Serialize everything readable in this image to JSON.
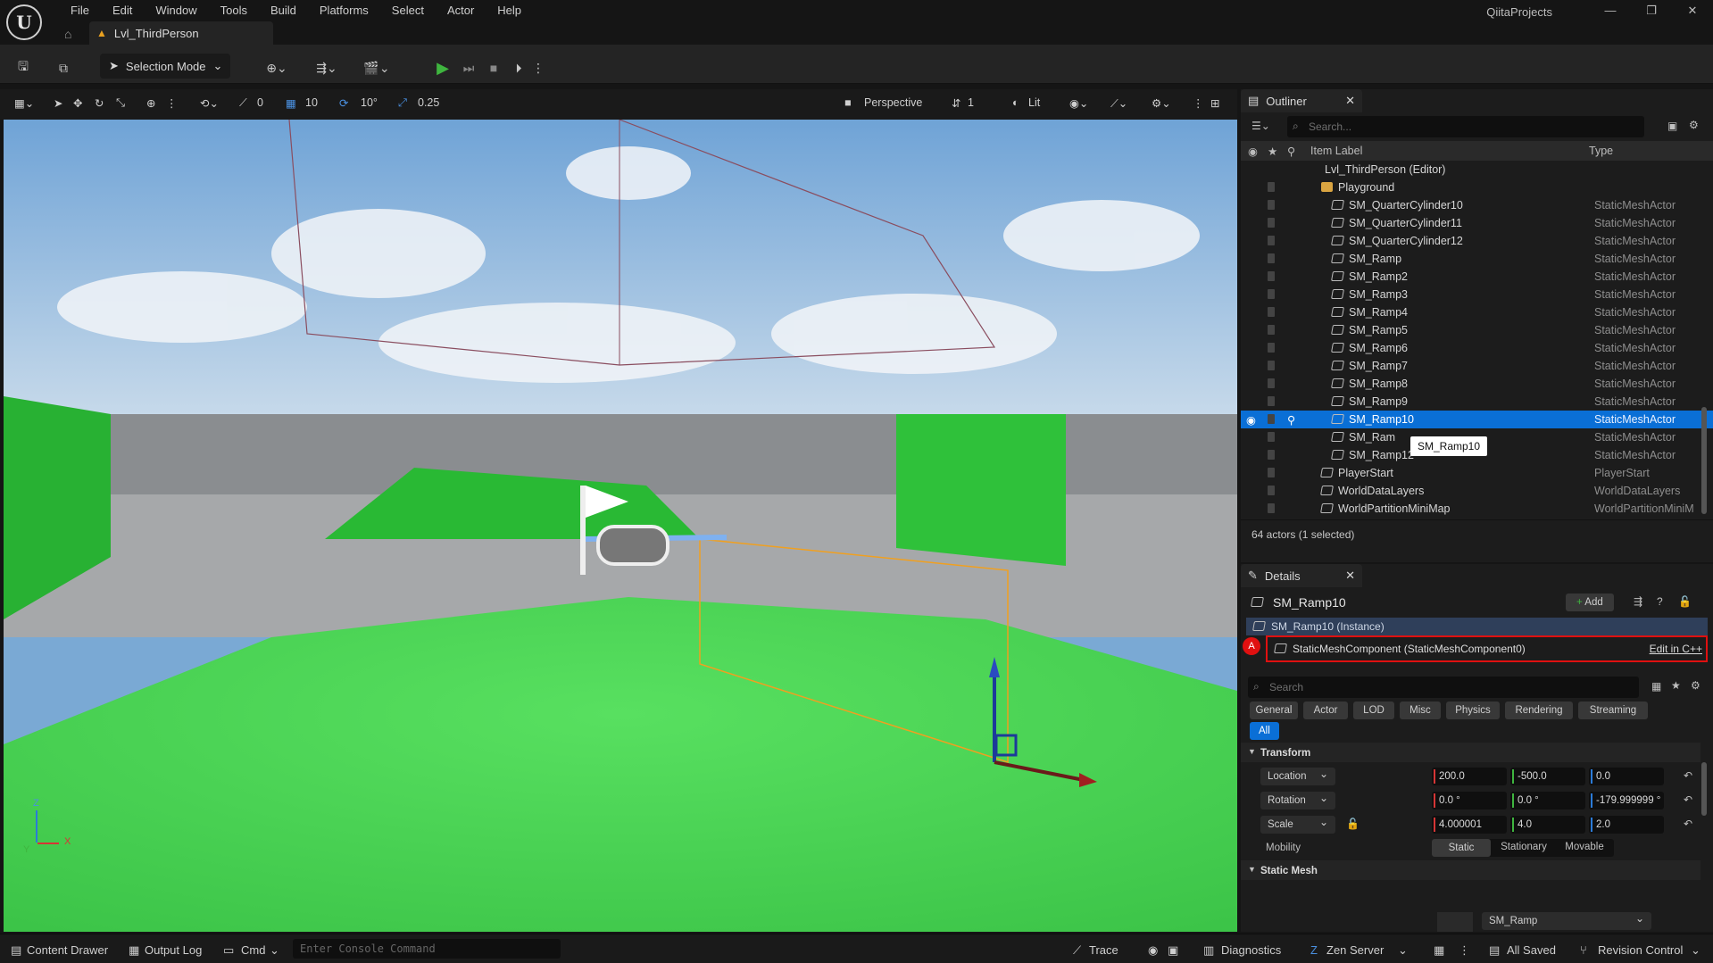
{
  "menubar": {
    "items": [
      "File",
      "Edit",
      "Window",
      "Tools",
      "Build",
      "Platforms",
      "Select",
      "Actor",
      "Help"
    ],
    "project": "QiitaProjects",
    "tab_label": "Lvl_ThirdPerson"
  },
  "toolbar": {
    "selection_mode": "Selection Mode"
  },
  "viewport_bar": {
    "grid_snap": "10",
    "rotation_snap": "10°",
    "scale_snap": "0.25",
    "zero_value": "0",
    "view_mode": "Perspective",
    "camera_speed": "1",
    "lighting": "Lit"
  },
  "viewport": {
    "axis_z": "Z",
    "axis_x": "X",
    "axis_y": "Y"
  },
  "outliner": {
    "title": "Outliner",
    "search_placeholder": "Search...",
    "col_label": "Item Label",
    "col_type": "Type",
    "rows": [
      {
        "label": "Lvl_ThirdPerson (Editor)",
        "type": "",
        "indent": 0
      },
      {
        "label": "Playground",
        "type": "",
        "indent": 1
      },
      {
        "label": "SM_QuarterCylinder10",
        "type": "StaticMeshActor",
        "indent": 2
      },
      {
        "label": "SM_QuarterCylinder11",
        "type": "StaticMeshActor",
        "indent": 2
      },
      {
        "label": "SM_QuarterCylinder12",
        "type": "StaticMeshActor",
        "indent": 2
      },
      {
        "label": "SM_Ramp",
        "type": "StaticMeshActor",
        "indent": 2
      },
      {
        "label": "SM_Ramp2",
        "type": "StaticMeshActor",
        "indent": 2
      },
      {
        "label": "SM_Ramp3",
        "type": "StaticMeshActor",
        "indent": 2
      },
      {
        "label": "SM_Ramp4",
        "type": "StaticMeshActor",
        "indent": 2
      },
      {
        "label": "SM_Ramp5",
        "type": "StaticMeshActor",
        "indent": 2
      },
      {
        "label": "SM_Ramp6",
        "type": "StaticMeshActor",
        "indent": 2
      },
      {
        "label": "SM_Ramp7",
        "type": "StaticMeshActor",
        "indent": 2
      },
      {
        "label": "SM_Ramp8",
        "type": "StaticMeshActor",
        "indent": 2
      },
      {
        "label": "SM_Ramp9",
        "type": "StaticMeshActor",
        "indent": 2
      },
      {
        "label": "SM_Ramp10",
        "type": "StaticMeshActor",
        "indent": 2,
        "selected": true
      },
      {
        "label": "SM_Ram",
        "type": "StaticMeshActor",
        "indent": 2
      },
      {
        "label": "SM_Ramp12",
        "type": "StaticMeshActor",
        "indent": 2
      },
      {
        "label": "PlayerStart",
        "type": "PlayerStart",
        "indent": 1
      },
      {
        "label": "WorldDataLayers",
        "type": "WorldDataLayers",
        "indent": 1
      },
      {
        "label": "WorldPartitionMiniMap",
        "type": "WorldPartitionMiniM",
        "indent": 1
      }
    ],
    "tooltip": "SM_Ramp10",
    "footer": "64 actors (1 selected)"
  },
  "details": {
    "title": "Details",
    "actor_name": "SM_Ramp10",
    "add_label": "Add",
    "instance_label": "SM_Ramp10 (Instance)",
    "component_label": "StaticMeshComponent (StaticMeshComponent0)",
    "edit_cpp": "Edit in C++",
    "search_placeholder": "Search",
    "filters": [
      "General",
      "Actor",
      "LOD",
      "Misc",
      "Physics",
      "Rendering",
      "Streaming"
    ],
    "filter_all": "All",
    "transform_section": "Transform",
    "location_label": "Location",
    "location": [
      "200.0",
      "-500.0",
      "0.0"
    ],
    "rotation_label": "Rotation",
    "rotation": [
      "0.0 °",
      "0.0 °",
      "-179.999999 °"
    ],
    "scale_label": "Scale",
    "scale": [
      "4.000001",
      "4.0",
      "2.0"
    ],
    "mobility_label": "Mobility",
    "mobility_options": [
      "Static",
      "Stationary",
      "Movable"
    ],
    "static_mesh_section": "Static Mesh",
    "static_mesh_value": "SM_Ramp"
  },
  "statusbar": {
    "content_drawer": "Content Drawer",
    "output_log": "Output Log",
    "cmd": "Cmd",
    "console_placeholder": "Enter Console Command",
    "trace": "Trace",
    "diagnostics": "Diagnostics",
    "zen_server": "Zen Server",
    "all_saved": "All Saved",
    "revision_control": "Revision Control"
  },
  "colors": {
    "selection": "#0a6fd6",
    "highlight_box": "#e01010",
    "play_green": "#3fb53f"
  }
}
